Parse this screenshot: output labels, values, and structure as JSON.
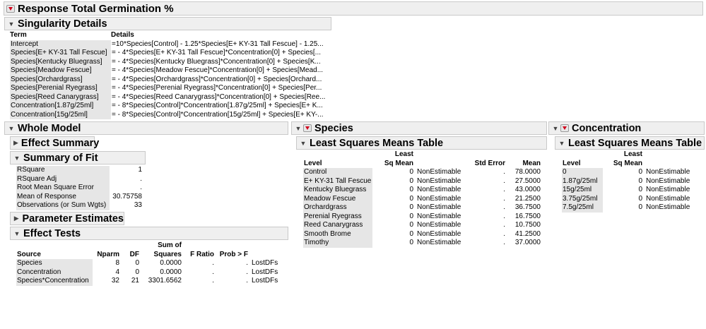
{
  "response_title": "Response Total Germination %",
  "singularity": {
    "title": "Singularity Details",
    "headers": [
      "Term",
      "Details"
    ],
    "rows": [
      [
        "Intercept",
        "=10*Species[Control] - 1.25*Species[E+ KY-31 Tall Fescue] - 1.25..."
      ],
      [
        "Species[E+ KY-31 Tall Fescue]",
        "= - 4*Species[E+ KY-31 Tall Fescue]*Concentration[0] + Species[..."
      ],
      [
        "Species[Kentucky Bluegrass]",
        "= - 4*Species[Kentucky Bluegrass]*Concentration[0] + Species[K..."
      ],
      [
        "Species[Meadow Fescue]",
        "= - 4*Species[Meadow Fescue]*Concentration[0] + Species[Mead..."
      ],
      [
        "Species[Orchardgrass]",
        "= - 4*Species[Orchardgrass]*Concentration[0] + Species[Orchard..."
      ],
      [
        "Species[Perenial Ryegrass]",
        "= - 4*Species[Perenial Ryegrass]*Concentration[0] + Species[Per..."
      ],
      [
        "Species[Reed Canarygrass]",
        "= - 4*Species[Reed Canarygrass]*Concentration[0] + Species[Ree..."
      ],
      [
        "Concentration[1.87g/25ml]",
        "= - 8*Species[Control]*Concentration[1.87g/25ml] + Species[E+ K..."
      ],
      [
        "Concentration[15g/25ml]",
        "= - 8*Species[Control]*Concentration[15g/25ml] + Species[E+ KY-..."
      ]
    ]
  },
  "whole_model": {
    "title": "Whole Model",
    "effect_summary": "Effect Summary",
    "summary_of_fit": {
      "title": "Summary of Fit",
      "rows": [
        [
          "RSquare",
          "1"
        ],
        [
          "RSquare Adj",
          "."
        ],
        [
          "Root Mean Square Error",
          "."
        ],
        [
          "Mean of Response",
          "30.75758"
        ],
        [
          "Observations (or Sum Wgts)",
          "33"
        ]
      ]
    },
    "parameter_estimates": "Parameter Estimates",
    "effect_tests": {
      "title": "Effect Tests",
      "headers": [
        "Source",
        "Nparm",
        "DF",
        "Sum of Squares",
        "F Ratio",
        "Prob > F",
        ""
      ],
      "header_line1": [
        "",
        "",
        "",
        "Sum of",
        "",
        "",
        ""
      ],
      "header_line2": [
        "Source",
        "Nparm",
        "DF",
        "Squares",
        "F Ratio",
        "Prob > F",
        ""
      ],
      "rows": [
        [
          "Species",
          "8",
          "0",
          "0.0000",
          ".",
          ".",
          "LostDFs"
        ],
        [
          "Concentration",
          "4",
          "0",
          "0.0000",
          ".",
          ".",
          "LostDFs"
        ],
        [
          "Species*Concentration",
          "32",
          "21",
          "3301.6562",
          ".",
          ".",
          "LostDFs"
        ]
      ]
    }
  },
  "species": {
    "title": "Species",
    "lsm_title": "Least Squares Means Table",
    "header_line1": [
      "",
      "Least",
      "",
      "",
      ""
    ],
    "header_line2": [
      "Level",
      "Sq Mean",
      "",
      "Std Error",
      "Mean"
    ],
    "rows": [
      [
        "Control",
        "0",
        "NonEstimable",
        ".",
        "78.0000"
      ],
      [
        "E+ KY-31 Tall Fescue",
        "0",
        "NonEstimable",
        ".",
        "27.5000"
      ],
      [
        "Kentucky Bluegrass",
        "0",
        "NonEstimable",
        ".",
        "43.0000"
      ],
      [
        "Meadow Fescue",
        "0",
        "NonEstimable",
        ".",
        "21.2500"
      ],
      [
        "Orchardgrass",
        "0",
        "NonEstimable",
        ".",
        "36.7500"
      ],
      [
        "Perenial Ryegrass",
        "0",
        "NonEstimable",
        ".",
        "16.7500"
      ],
      [
        "Reed Canarygrass",
        "0",
        "NonEstimable",
        ".",
        "10.7500"
      ],
      [
        "Smooth Brome",
        "0",
        "NonEstimable",
        ".",
        "41.2500"
      ],
      [
        "Timothy",
        "0",
        "NonEstimable",
        ".",
        "37.0000"
      ]
    ]
  },
  "concentration": {
    "title": "Concentration",
    "lsm_title": "Least Squares Means Table",
    "header_line1": [
      "",
      "Least",
      ""
    ],
    "header_line2": [
      "Level",
      "Sq Mean",
      ""
    ],
    "rows": [
      [
        "0",
        "0",
        "NonEstimable"
      ],
      [
        "1.87g/25ml",
        "0",
        "NonEstimable"
      ],
      [
        "15g/25ml",
        "0",
        "NonEstimable"
      ],
      [
        "3.75g/25ml",
        "0",
        "NonEstimable"
      ],
      [
        "7.5g/25ml",
        "0",
        "NonEstimable"
      ]
    ]
  },
  "colors": {
    "outline_bg": "#efefef",
    "level_shade": "#e6e6e6",
    "menu_triangle": "#d0021b"
  }
}
